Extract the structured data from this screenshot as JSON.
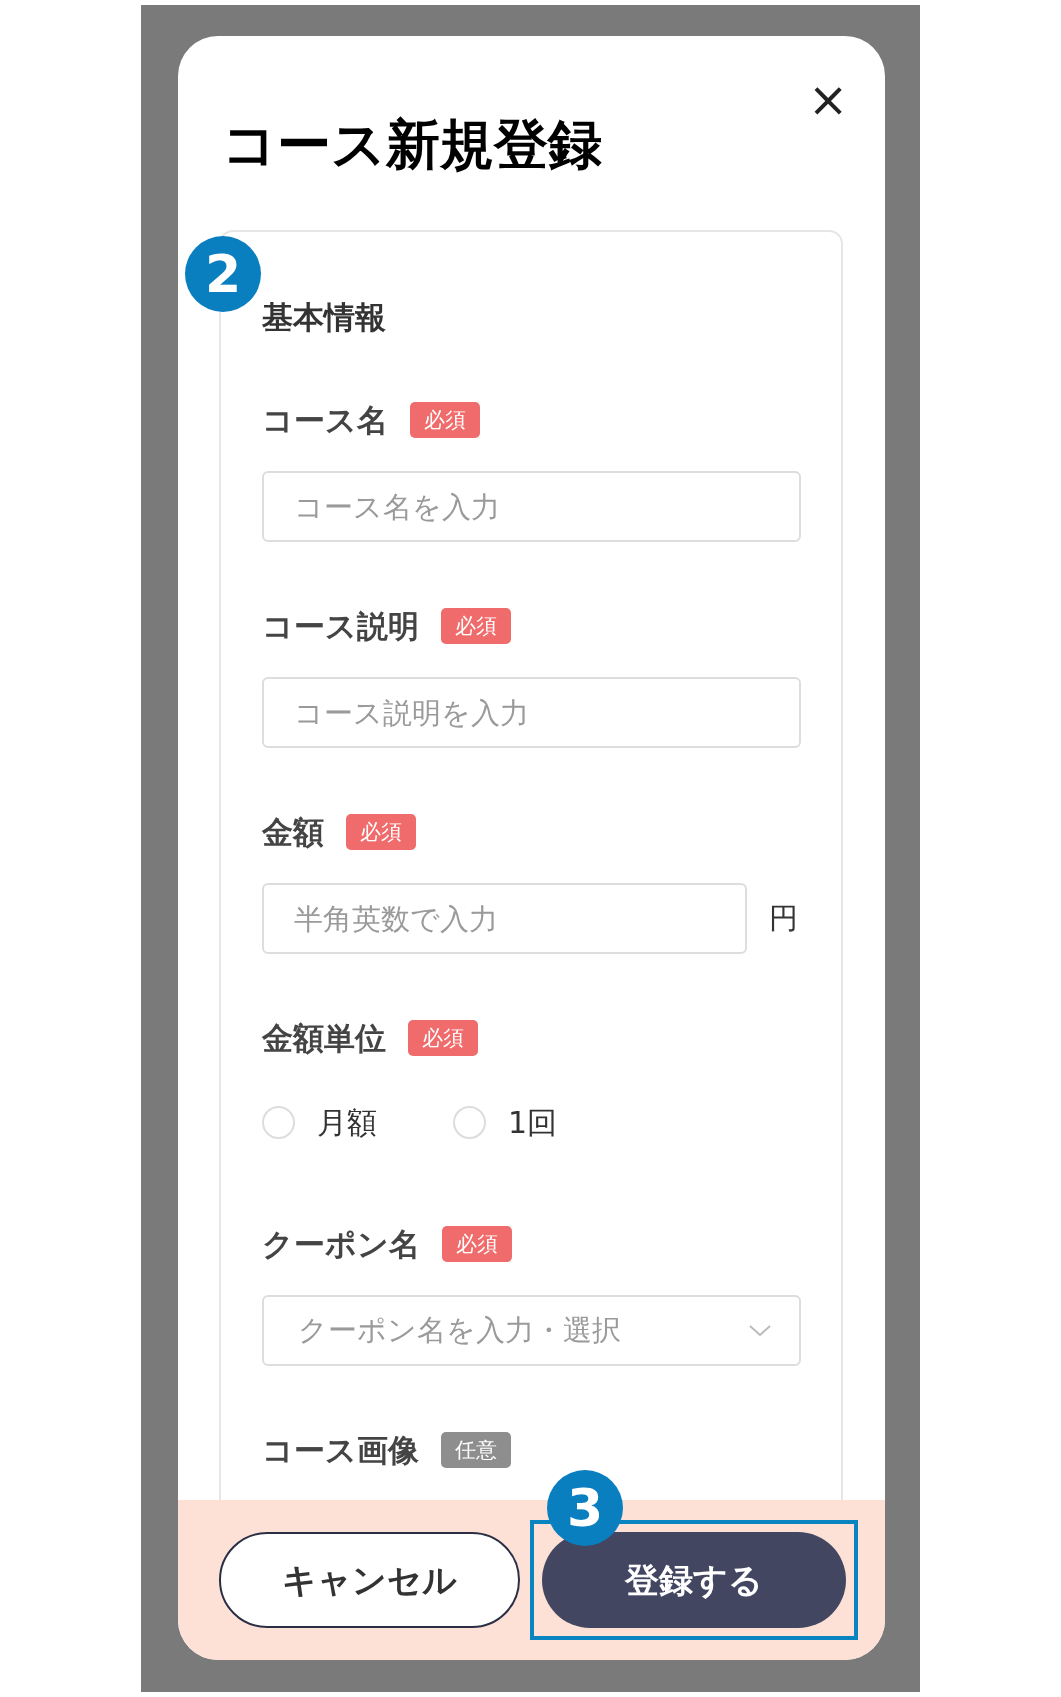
{
  "dialog": {
    "title": "コース新規登録",
    "close_label": "×"
  },
  "section": {
    "marker": "2",
    "heading": "基本情報"
  },
  "fields": [
    {
      "kind": "text",
      "label": "コース名",
      "badge": "必須",
      "required": true,
      "placeholder": "コース名を入力"
    },
    {
      "kind": "text",
      "label": "コース説明",
      "badge": "必須",
      "required": true,
      "placeholder": "コース説明を入力"
    },
    {
      "kind": "unit",
      "label": "金額",
      "badge": "必須",
      "required": true,
      "placeholder": "半角英数で入力",
      "unit": "円"
    },
    {
      "kind": "radio",
      "label": "金額単位",
      "badge": "必須",
      "required": true,
      "options": [
        {
          "label": "月額",
          "selected": false
        },
        {
          "label": "1回",
          "selected": false
        }
      ]
    },
    {
      "kind": "select",
      "label": "クーポン名",
      "badge": "必須",
      "required": true,
      "placeholder": "クーポン名を入力・選択"
    },
    {
      "kind": "image",
      "label": "コース画像",
      "badge": "任意",
      "required": false
    }
  ],
  "footer": {
    "marker": "3",
    "buttons": [
      {
        "kind": "secondary",
        "label": "キャンセル",
        "highlighted": false
      },
      {
        "kind": "primary",
        "label": "登録する",
        "highlighted": true
      }
    ]
  }
}
